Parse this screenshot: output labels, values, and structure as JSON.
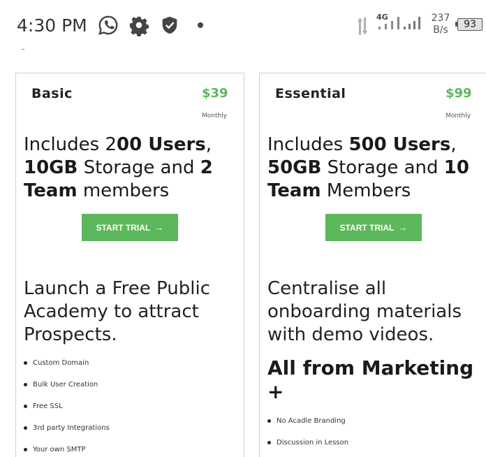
{
  "status_bar": {
    "time": "4:30 PM",
    "network_type": "4G",
    "speed_value": "237",
    "speed_unit": "B/s",
    "battery_level": "93",
    "icons": [
      "whatsapp-icon",
      "gear-icon",
      "shield-check-icon",
      "notification-dot",
      "data-transfer-icon",
      "signal-icon",
      "battery-icon"
    ]
  },
  "plans": [
    {
      "name": "Basic",
      "price": "$39",
      "period": "Monthly",
      "includes": {
        "prefix": "Includes 2",
        "users": "00 Users",
        "sep1": ",",
        "storage": "10GB",
        "storage_text": " Storage and ",
        "team_count": "2",
        "team_word": "Team",
        "team_text": " members"
      },
      "cta": "START TRIAL",
      "feature_title": "Launch a Free Public Academy to attract Prospects.",
      "features": [
        "Custom Domain",
        "Bulk User Creation",
        "Free SSL",
        "3rd party Integrations",
        "Your own SMTP"
      ]
    },
    {
      "name": "Essential",
      "price": "$99",
      "period": "Monthly",
      "includes": {
        "prefix": "Includes ",
        "users": "500 Users",
        "sep1": ",",
        "storage": "50GB",
        "storage_text": " Storage and ",
        "team_count": "10",
        "team_word": "Team",
        "team_text": " Members"
      },
      "cta": "START TRIAL",
      "feature_title": "Centralise all onboarding materials with demo videos.",
      "feature_subtitle": "All from Marketing +",
      "features": [
        "No Acadle Branding",
        "Discussion in Lesson"
      ]
    }
  ],
  "colors": {
    "accent": "#5cb85c",
    "card_border": "#b9e2b9",
    "text": "#1a1a1a"
  }
}
